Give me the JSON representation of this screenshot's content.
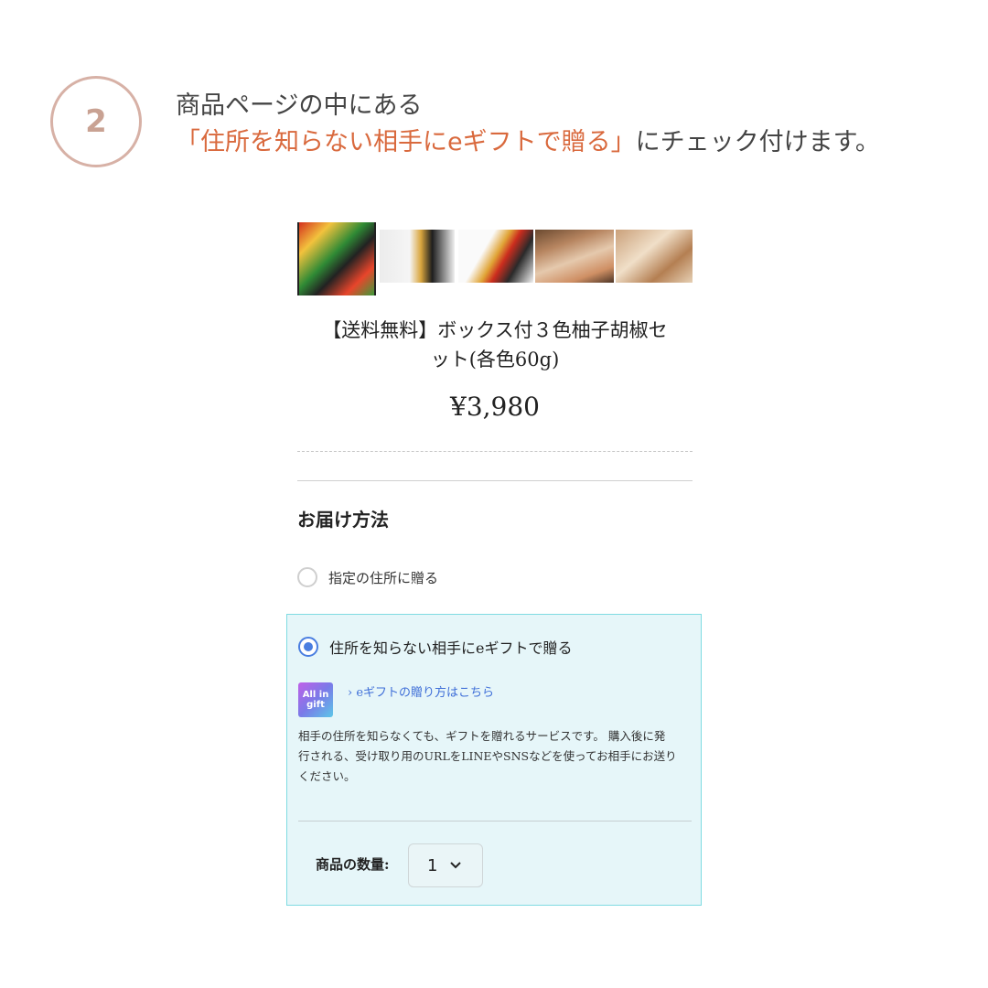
{
  "step": {
    "number": "2",
    "line1": "商品ページの中にある",
    "line2_highlight": "「住所を知らない相手にeギフトで贈る」",
    "line2_rest": "にチェック付けます。"
  },
  "product": {
    "title_line1": "【送料無料】ボックス付３色柚子胡椒セ",
    "title_line2": "ット(各色60g)",
    "price": "¥3,980"
  },
  "delivery": {
    "heading": "お届け方法",
    "option1": "指定の住所に贈る",
    "option2": "住所を知らない相手にeギフトで贈る",
    "gift_logo": "All in gift",
    "gift_link": "› eギフトの贈り方はこちら",
    "description_lines": [
      "相手の住所を知らなくても、ギフトを贈れるサービスです。 購入後に発",
      "行される、受け取り用のURLをLINEやSNSなどを使ってお相手にお送り",
      "ください。"
    ]
  },
  "quantity": {
    "label": "商品の数量:",
    "value": "1",
    "chevron": "chevron-down-icon"
  },
  "colors": {
    "highlight": "#d9693d",
    "panel_bg": "#e6f6f9",
    "panel_border": "#7fdbe2",
    "radio_selected": "#4a7ee0",
    "step_circle": "#d7b1a6"
  }
}
